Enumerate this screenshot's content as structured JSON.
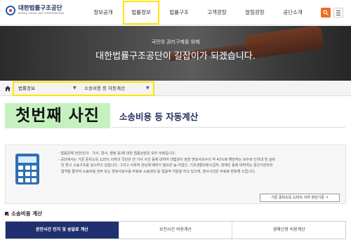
{
  "header": {
    "logo_kr": "대한법률구조공단",
    "logo_en": "KOREA LEGAL AID CORPORATION",
    "nav": [
      {
        "label": "정보공개"
      },
      {
        "label": "법률정보"
      },
      {
        "label": "법률구조"
      },
      {
        "label": "고객광장"
      },
      {
        "label": "알림광장"
      },
      {
        "label": "공단소개"
      }
    ],
    "active_nav": "법률정보",
    "accent_color": "#ef6d1e",
    "highlight_color": "#ffe400"
  },
  "banner": {
    "subtitle": "국민의 권리구제를 위해",
    "title": "대한법률구조공단이 길잡이가 되겠습니다."
  },
  "breadcrumb": {
    "level1": "법률정보",
    "level2": "소송비용 등 자동계산"
  },
  "annotation": {
    "label": "첫번째 사진"
  },
  "page": {
    "title": "소송비용 등 자동계산"
  },
  "info": {
    "lines": [
      "- 법률문제 전반(민사 · 가사, 형사, 행정 등)에 대한 법률상담은 모두 무료입니다.",
      "- 공단에서는 기준 중위소득 125% 이하의 국민은 전 가사 사건 등에 대하여 대법원이 정한 변호사보수의 약 42%에 해당하는 보수와 인지대 및 실비",
      "만 받고 소송구조를 실시하고 있습니다. 그리고 사회적 관심계 배려가 필요한 농·어업인, 기초생활보장수급자, 장애인 등에 대하여는 중인거관과의",
      "협약을 통하여 소송비용 전부 또는 변호사보수를 무료로 소송대리 등 법률적 지원을 하고 있으며, 형사사건은 무료로 변호해 드립니다."
    ],
    "criteria_button": "기준 중위소득 125% 이하 판단기준"
  },
  "section": {
    "title": "소송비용 계산"
  },
  "tabs": [
    {
      "label": "본안사건 인지 및 송달료 계산",
      "active": true
    },
    {
      "label": "보전사건 비용계산",
      "active": false
    },
    {
      "label": "경매신청 비용계산",
      "active": false
    }
  ]
}
